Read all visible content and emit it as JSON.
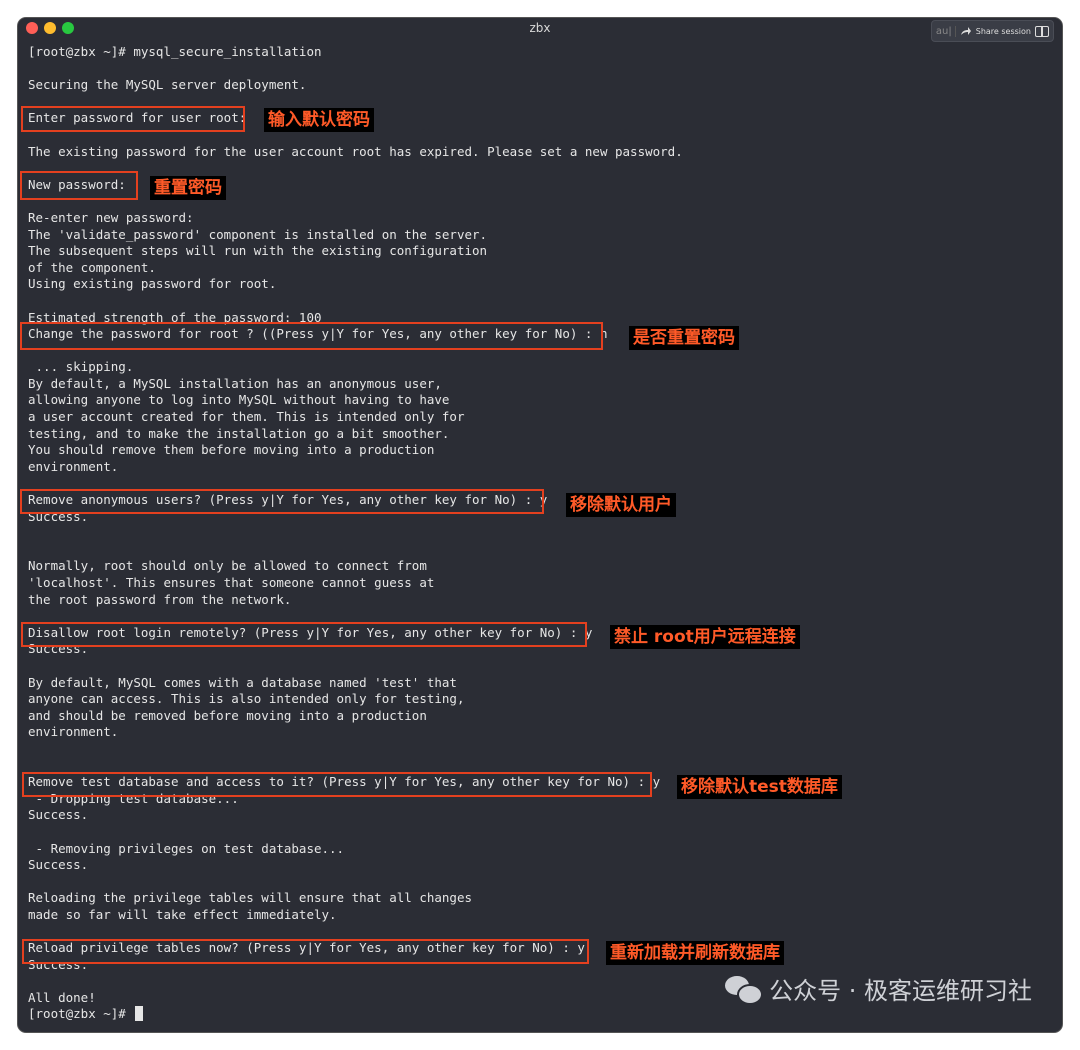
{
  "window": {
    "title": "zbx"
  },
  "share": {
    "au": "au|",
    "label": "Share session"
  },
  "terminal": {
    "lines": [
      "[root@zbx ~]# mysql_secure_installation",
      "",
      "Securing the MySQL server deployment.",
      "",
      "Enter password for user root:",
      "",
      "The existing password for the user account root has expired. Please set a new password.",
      "",
      "New password:",
      "",
      "Re-enter new password:",
      "The 'validate_password' component is installed on the server.",
      "The subsequent steps will run with the existing configuration",
      "of the component.",
      "Using existing password for root.",
      "",
      "Estimated strength of the password: 100",
      "Change the password for root ? ((Press y|Y for Yes, any other key for No) : n",
      "",
      " ... skipping.",
      "By default, a MySQL installation has an anonymous user,",
      "allowing anyone to log into MySQL without having to have",
      "a user account created for them. This is intended only for",
      "testing, and to make the installation go a bit smoother.",
      "You should remove them before moving into a production",
      "environment.",
      "",
      "Remove anonymous users? (Press y|Y for Yes, any other key for No) : y",
      "Success.",
      "",
      "",
      "Normally, root should only be allowed to connect from",
      "'localhost'. This ensures that someone cannot guess at",
      "the root password from the network.",
      "",
      "Disallow root login remotely? (Press y|Y for Yes, any other key for No) : y",
      "Success.",
      "",
      "By default, MySQL comes with a database named 'test' that",
      "anyone can access. This is also intended only for testing,",
      "and should be removed before moving into a production",
      "environment.",
      "",
      "",
      "Remove test database and access to it? (Press y|Y for Yes, any other key for No) : y",
      " - Dropping test database...",
      "Success.",
      "",
      " - Removing privileges on test database...",
      "Success.",
      "",
      "Reloading the privilege tables will ensure that all changes",
      "made so far will take effect immediately.",
      "",
      "Reload privilege tables now? (Press y|Y for Yes, any other key for No) : y",
      "Success.",
      "",
      "All done!",
      "[root@zbx ~]# "
    ]
  },
  "annotations": [
    "输入默认密码",
    "重置密码",
    "是否重置密码",
    "移除默认用户",
    "禁止 root用户远程连接",
    "移除默认test数据库",
    "重新加载并刷新数据库"
  ],
  "watermark": "公众号 · 极客运维研习社",
  "colors": {
    "terminal_bg": "#2b2d35",
    "text": "#e6e6e6",
    "highlight": "#e4401f",
    "note_text": "#ff5a28"
  }
}
